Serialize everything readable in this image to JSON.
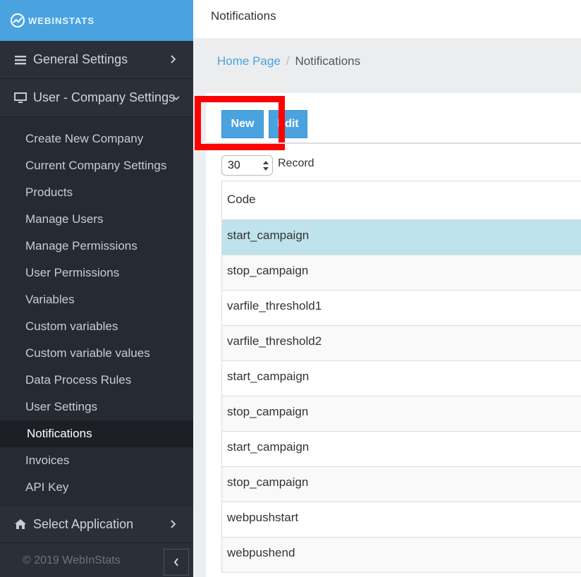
{
  "brand": {
    "name": "WEBINSTATS"
  },
  "topbar": {
    "title": "Notifications"
  },
  "breadcrumb": {
    "home": "Home Page",
    "separator": "/",
    "current": "Notifications"
  },
  "sidebar": {
    "general_settings": "General Settings",
    "user_company_settings": "User - Company Settings",
    "items": [
      "Create New Company",
      "Current Company Settings",
      "Products",
      "Manage Users",
      "Manage Permissions",
      "User Permissions",
      "Variables",
      "Custom variables",
      "Custom variable values",
      "Data Process Rules",
      "User Settings",
      "Notifications",
      "Invoices",
      "API Key"
    ],
    "select_application": "Select Application",
    "footer": "© 2019 WebInStats"
  },
  "toolbar": {
    "new_label": "New",
    "edit_label": "Edit"
  },
  "records": {
    "value": "30",
    "label": "Record"
  },
  "table": {
    "header": "Code",
    "rows": [
      "start_campaign",
      "stop_campaign",
      "varfile_threshold1",
      "varfile_threshold2",
      "start_campaign",
      "stop_campaign",
      "start_campaign",
      "stop_campaign",
      "webpushstart",
      "webpushend"
    ]
  },
  "colors": {
    "accent": "#4aa3df",
    "sidebar": "#2b2f38",
    "highlight": "#ff0000",
    "selected_row": "#bfe3ec"
  }
}
